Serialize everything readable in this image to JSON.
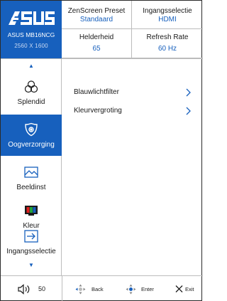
{
  "brand": {
    "logo_text": "/SUS",
    "model": "ASUS MB16NCG",
    "resolution": "2560 X 1600",
    "color": "#1760bd"
  },
  "info": {
    "preset_label": "ZenScreen Preset",
    "preset_value": "Standaard",
    "input_label": "Ingangsselectie",
    "input_value": "HDMI",
    "brightness_label": "Helderheid",
    "brightness_value": "65",
    "refresh_label": "Refresh Rate",
    "refresh_value": "60 Hz"
  },
  "sidebar": {
    "items": [
      {
        "label": "Splendid",
        "icon": "splendid-icon",
        "active": false
      },
      {
        "label": "Oogverzorging",
        "icon": "eye-care-icon",
        "active": true
      },
      {
        "label": "Beeldinst",
        "icon": "image-icon",
        "active": false
      },
      {
        "label": "Kleur",
        "icon": "color-icon",
        "active": false
      },
      {
        "label": "Ingangsselectie",
        "icon": "input-icon",
        "active": false
      }
    ]
  },
  "main": {
    "rows": [
      {
        "label": "Blauwlichtfilter"
      },
      {
        "label": "Kleurvergroting"
      }
    ]
  },
  "footer": {
    "volume_value": "50",
    "back_label": "Back",
    "enter_label": "Enter",
    "exit_label": "Exit"
  },
  "colors": {
    "accent": "#1760bd",
    "text": "#1a1a1a",
    "divider": "#bcbcbc"
  }
}
